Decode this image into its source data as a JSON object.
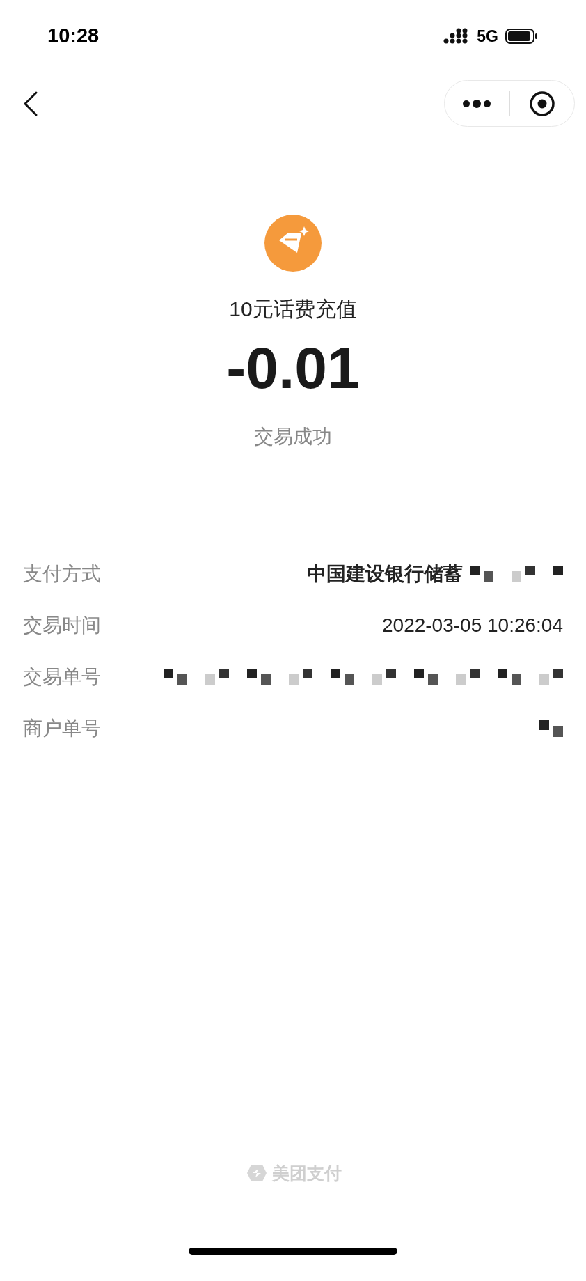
{
  "status_bar": {
    "time": "10:28",
    "network": "5G"
  },
  "order": {
    "title": "10元话费充值",
    "amount": "-0.01",
    "status": "交易成功"
  },
  "details": [
    {
      "label": "支付方式",
      "value": "中国建设银行储蓄",
      "redacted": true,
      "bold": true
    },
    {
      "label": "交易时间",
      "value": "2022-03-05 10:26:04",
      "redacted": false,
      "bold": false
    },
    {
      "label": "交易单号",
      "redacted": true
    },
    {
      "label": "商户单号",
      "redacted": true
    }
  ],
  "footer": {
    "brand": "美团支付"
  }
}
